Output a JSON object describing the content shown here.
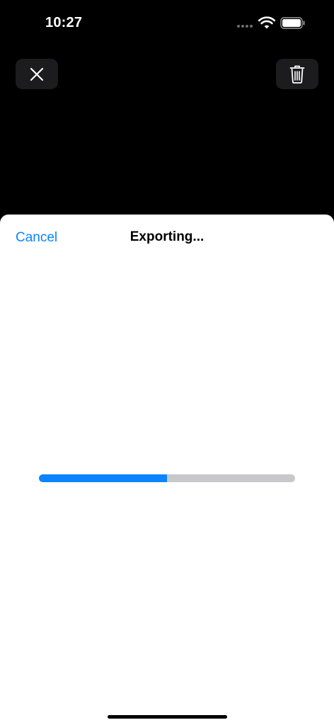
{
  "status_bar": {
    "time": "10:27",
    "icons": [
      "signal-dots-icon",
      "wifi-icon",
      "battery-icon"
    ]
  },
  "toolbar": {
    "close_icon": "close-icon",
    "delete_icon": "trash-icon"
  },
  "sheet": {
    "cancel_label": "Cancel",
    "title": "Exporting..."
  },
  "progress": {
    "fraction": 0.5
  },
  "colors": {
    "accent": "#0a84ff",
    "progress_track": "#c7c7cc",
    "background": "#000000",
    "sheet_background": "#ffffff"
  }
}
